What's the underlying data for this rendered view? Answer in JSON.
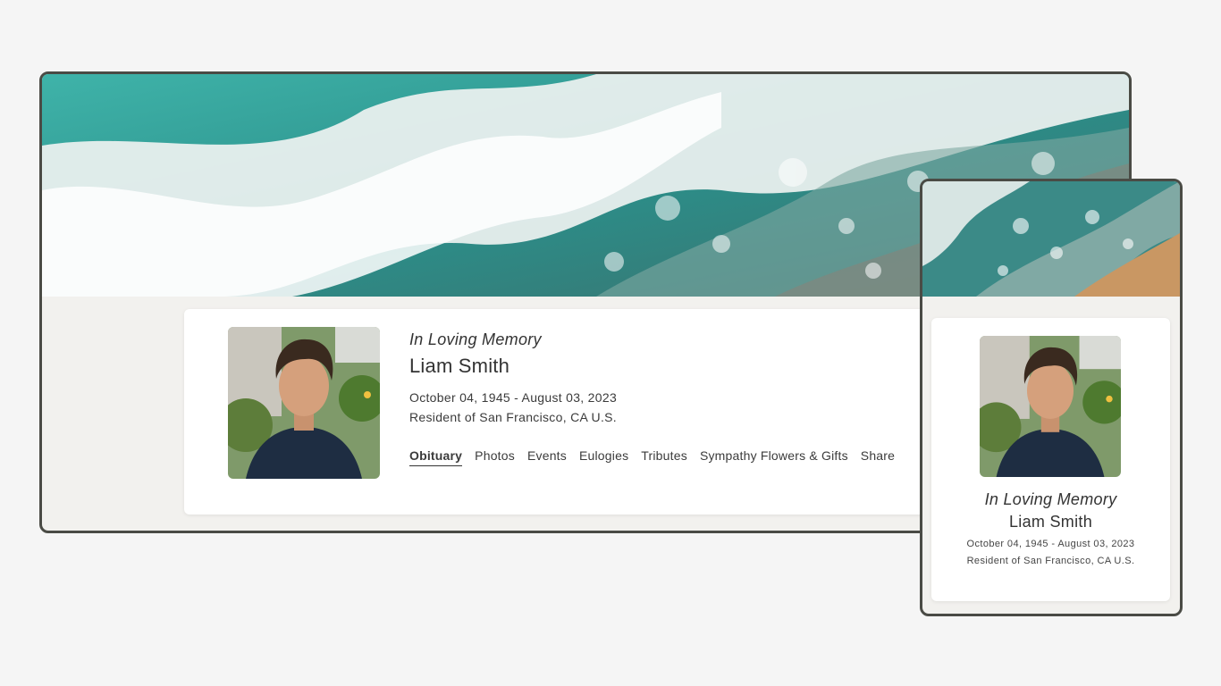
{
  "profile": {
    "memory_label": "In Loving Memory",
    "name": "Liam Smith",
    "dates": "October 04, 1945 - August 03, 2023",
    "residence": "Resident of San Francisco, CA U.S."
  },
  "tabs": [
    {
      "label": "Obituary",
      "active": true
    },
    {
      "label": "Photos",
      "active": false
    },
    {
      "label": "Events",
      "active": false
    },
    {
      "label": "Eulogies",
      "active": false
    },
    {
      "label": "Tributes",
      "active": false
    },
    {
      "label": "Sympathy Flowers & Gifts",
      "active": false
    },
    {
      "label": "Share",
      "active": false
    }
  ],
  "colors": {
    "frame_border": "#4a4b45",
    "page_background": "#f5f5f5",
    "panel_background": "#f2f1ee",
    "sea_teal": "#2fa59e",
    "foam": "#f4f6f5",
    "sand": "#c99763"
  },
  "images": {
    "banner": "ocean-waves-banner",
    "portrait": "portrait-photo"
  }
}
